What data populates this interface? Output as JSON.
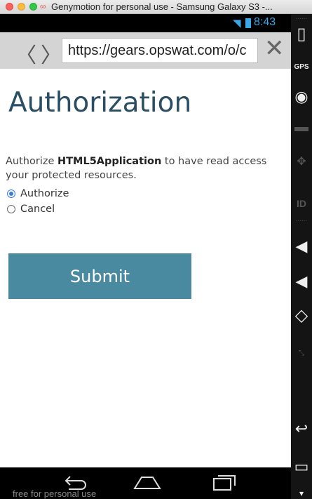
{
  "window": {
    "title": "Genymotion for personal use - Samsung Galaxy S3 -..."
  },
  "status_bar": {
    "time": "8:43"
  },
  "browser": {
    "url": "https://gears.opswat.com/o/c"
  },
  "page": {
    "title": "Authorization",
    "description_prefix": "Authorize",
    "app_name": "HTML5Application",
    "description_suffix": "to have read access",
    "description_line2": "your protected resources.",
    "options": [
      {
        "label": "Authorize",
        "selected": true
      },
      {
        "label": "Cancel",
        "selected": false
      }
    ],
    "submit_label": "Submit"
  },
  "watermark": "free for personal use",
  "toolbar": {
    "gps_label": "GPS",
    "id_label": "ID"
  },
  "colors": {
    "accent": "#4a8aa0",
    "title": "#2a4e63",
    "status": "#3aa8e8"
  }
}
